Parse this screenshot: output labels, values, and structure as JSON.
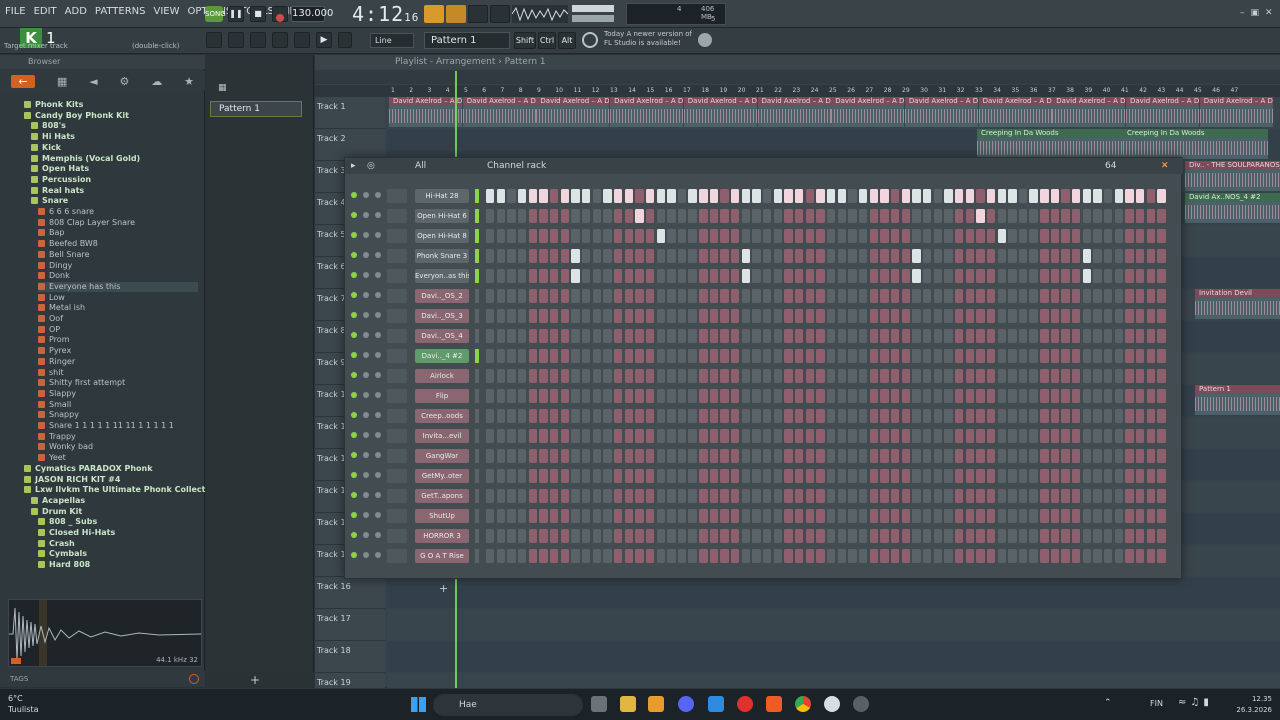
{
  "menu": [
    "FILE",
    "EDIT",
    "ADD",
    "PATTERNS",
    "VIEW",
    "OPTIONS",
    "TOOLS",
    "HELP"
  ],
  "transport": {
    "song_label": "SONG",
    "tempo": "130.000",
    "time": "4:12",
    "time_sub": "16"
  },
  "cpu": {
    "value1": "4",
    "mem": "406 MB",
    "value2": "5"
  },
  "hint": {
    "target": "Target mixer track",
    "dbl": "(double-click)"
  },
  "toolbar": {
    "snap": "Line",
    "pattern": "Pattern 1",
    "shift": "Shift",
    "ctrl": "Ctrl",
    "alt": "Alt"
  },
  "news": {
    "line1": "Today  A newer version of",
    "line2": "FL Studio is available!"
  },
  "browser": {
    "title": "Browser",
    "tree": [
      {
        "t": "Phonk Kits",
        "k": "folder",
        "lvl": 2
      },
      {
        "t": "Candy Boy Phonk Kit",
        "k": "folder",
        "lvl": 2
      },
      {
        "t": "808's",
        "k": "folder",
        "lvl": 3
      },
      {
        "t": "Hi Hats",
        "k": "folder",
        "lvl": 3
      },
      {
        "t": "Kick",
        "k": "folder",
        "lvl": 3
      },
      {
        "t": "Memphis (Vocal Gold)",
        "k": "folder",
        "lvl": 3
      },
      {
        "t": "Open Hats",
        "k": "folder",
        "lvl": 3
      },
      {
        "t": "Percussion",
        "k": "folder",
        "lvl": 3
      },
      {
        "t": "Real hats",
        "k": "folder",
        "lvl": 3
      },
      {
        "t": "Snare",
        "k": "folder",
        "lvl": 3
      },
      {
        "t": "6 6 6 snare",
        "k": "file",
        "lvl": 4
      },
      {
        "t": "808 Clap Layer Snare",
        "k": "file",
        "lvl": 4
      },
      {
        "t": "Bap",
        "k": "file",
        "lvl": 4
      },
      {
        "t": "Beefed BW8",
        "k": "file",
        "lvl": 4
      },
      {
        "t": "Bell Snare",
        "k": "file",
        "lvl": 4
      },
      {
        "t": "Dingy",
        "k": "file",
        "lvl": 4
      },
      {
        "t": "Donk",
        "k": "file",
        "lvl": 4
      },
      {
        "t": "Everyone has this",
        "k": "file",
        "lvl": 4,
        "sel": true
      },
      {
        "t": "Low",
        "k": "file",
        "lvl": 4
      },
      {
        "t": "Metal ish",
        "k": "file",
        "lvl": 4
      },
      {
        "t": "Oof",
        "k": "file",
        "lvl": 4
      },
      {
        "t": "OP",
        "k": "file",
        "lvl": 4
      },
      {
        "t": "Prom",
        "k": "file",
        "lvl": 4
      },
      {
        "t": "Pyrex",
        "k": "file",
        "lvl": 4
      },
      {
        "t": "Ringer",
        "k": "file",
        "lvl": 4
      },
      {
        "t": "shit",
        "k": "file",
        "lvl": 4
      },
      {
        "t": "Shitty first attempt",
        "k": "file",
        "lvl": 4
      },
      {
        "t": "Slappy",
        "k": "file",
        "lvl": 4
      },
      {
        "t": "Small",
        "k": "file",
        "lvl": 4
      },
      {
        "t": "Snappy",
        "k": "file",
        "lvl": 4
      },
      {
        "t": "Snare 1 1 1 1 1 11 11 1 1 1 1 1",
        "k": "file",
        "lvl": 4
      },
      {
        "t": "Trappy",
        "k": "file",
        "lvl": 4
      },
      {
        "t": "Wonky bad",
        "k": "file",
        "lvl": 4
      },
      {
        "t": "Yeet",
        "k": "file",
        "lvl": 4
      },
      {
        "t": "Cymatics PARADOX Phonk",
        "k": "folder",
        "lvl": 2
      },
      {
        "t": "JASON RICH KIT #4",
        "k": "folder",
        "lvl": 2
      },
      {
        "t": "Lxw Ilvkm The Ultimate Phonk Collection Vol.2",
        "k": "folder",
        "lvl": 2
      },
      {
        "t": "Acapellas",
        "k": "folder",
        "lvl": 3
      },
      {
        "t": "Drum Kit",
        "k": "folder",
        "lvl": 3
      },
      {
        "t": "808 _ Subs",
        "k": "folder",
        "lvl": 4
      },
      {
        "t": "Closed Hi-Hats",
        "k": "folder",
        "lvl": 4
      },
      {
        "t": "Crash",
        "k": "folder",
        "lvl": 4
      },
      {
        "t": "Cymbals",
        "k": "folder",
        "lvl": 4
      },
      {
        "t": "Hard 808",
        "k": "folder",
        "lvl": 4
      }
    ],
    "sample_info": "44.1 kHz 32",
    "tags": "TAGS"
  },
  "patterns": {
    "item": "Pattern 1"
  },
  "playlist": {
    "title": "Playlist - Arrangement › Pattern 1",
    "ruler": [
      1,
      2,
      3,
      4,
      5,
      6,
      7,
      8,
      9,
      10,
      11,
      12,
      13,
      14,
      15,
      16,
      17,
      18,
      19,
      20,
      21,
      22,
      23,
      24,
      25,
      26,
      27,
      28,
      29,
      30,
      31,
      32,
      33,
      34,
      35,
      36,
      37,
      38,
      39,
      40,
      41,
      42,
      43,
      44,
      45,
      46,
      47
    ],
    "tracks": [
      "Track 1",
      "Track 2",
      "Track 3",
      "Track 4",
      "Track 5",
      "Track 6",
      "Track 7",
      "Track 8",
      "Track 9",
      "Track 10",
      "Track 11",
      "Track 12",
      "Track 13",
      "Track 14",
      "Track 15",
      "Track 16",
      "Track 17",
      "Track 18",
      "Track 19"
    ],
    "clip_main": "David Axelrod – A Div.. - THE SOULPARANOS_2",
    "clip_woods": "Creeping In Da Woods",
    "clip_soulp4": "Div.. - THE SOULPARANOS_4",
    "clip_soulp4b": "David Ax..NOS_4 #2",
    "clip_devil": "Invitation Devil",
    "clip_pattern": "Pattern 1"
  },
  "rack": {
    "title": "Channel rack",
    "filter": "All",
    "swing": "64",
    "channels": [
      {
        "name": "Hi-Hat 28",
        "style": "grey",
        "steps": [
          0,
          4,
          8,
          12,
          16,
          20,
          24,
          28,
          32,
          36,
          40,
          44,
          48,
          52,
          56,
          60,
          1,
          3,
          5,
          7,
          9,
          11,
          13,
          15,
          17,
          19,
          21,
          23,
          25,
          27,
          29,
          31,
          33,
          35,
          37,
          39,
          41,
          43,
          45,
          47,
          49,
          51,
          53,
          55,
          57,
          59,
          61,
          63
        ]
      },
      {
        "name": "Open Hi-Hat 6",
        "style": "grey",
        "steps": [
          14,
          46
        ]
      },
      {
        "name": "Open Hi-Hat 8",
        "style": "grey",
        "steps": [
          16,
          48
        ]
      },
      {
        "name": "Phonk Snare 3",
        "style": "grey",
        "steps": [
          8,
          24,
          40,
          56
        ]
      },
      {
        "name": "Everyon..as this",
        "style": "grey",
        "steps": [
          8,
          24,
          40,
          56
        ]
      },
      {
        "name": "Davi.._OS_2",
        "style": "pink",
        "steps": []
      },
      {
        "name": "Davi.._OS_3",
        "style": "pink",
        "steps": []
      },
      {
        "name": "Davi.._OS_4",
        "style": "pink",
        "steps": []
      },
      {
        "name": "Davi.._4 #2",
        "style": "active",
        "steps": []
      },
      {
        "name": "Airlock",
        "style": "pink",
        "steps": []
      },
      {
        "name": "Flip",
        "style": "pink",
        "steps": []
      },
      {
        "name": "Creep..oods",
        "style": "pink",
        "steps": []
      },
      {
        "name": "Invita...evil",
        "style": "pink",
        "steps": []
      },
      {
        "name": "GangWar",
        "style": "pink",
        "steps": []
      },
      {
        "name": "GetMy..oter",
        "style": "pink",
        "steps": []
      },
      {
        "name": "GetT..apons",
        "style": "pink",
        "steps": []
      },
      {
        "name": "ShutUp",
        "style": "pink",
        "steps": []
      },
      {
        "name": "HORROR 3",
        "style": "pink",
        "steps": []
      },
      {
        "name": "G O A T Rise",
        "style": "pink",
        "steps": []
      }
    ]
  },
  "taskbar": {
    "temp": "6°C",
    "place": "Tuulista",
    "search": "Hae",
    "lang": "FIN",
    "time": "12.35",
    "date": "26.3.2026"
  },
  "colors": {
    "accent": "#d4611f",
    "led_on": "#8ed24a",
    "step_on": "#dde4e6",
    "step_alt": "#8e5f6c"
  }
}
